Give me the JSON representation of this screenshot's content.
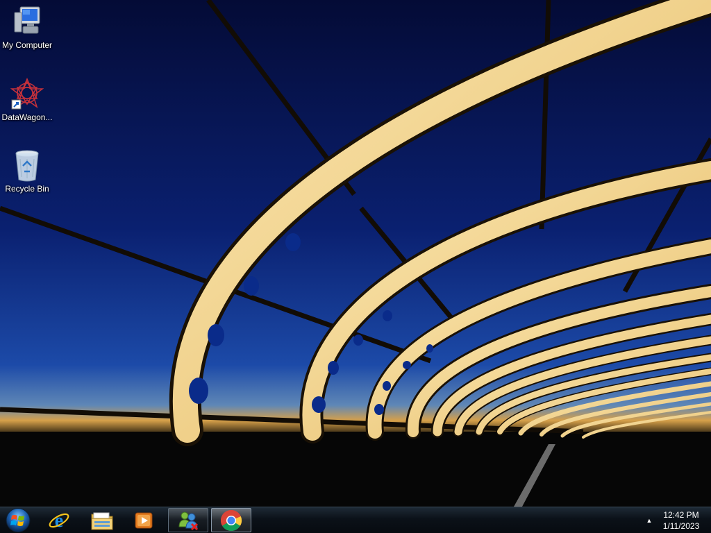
{
  "desktop": {
    "icons": [
      {
        "label": "My Computer",
        "icon": "computer-icon"
      },
      {
        "label": "DataWagon...",
        "icon": "datawagon-shortcut-icon"
      },
      {
        "label": "Recycle Bin",
        "icon": "recycle-bin-icon"
      }
    ]
  },
  "taskbar": {
    "start": {
      "icon": "windows-start-orb-icon"
    },
    "pinned": [
      {
        "icon": "internet-explorer-icon",
        "running": false
      },
      {
        "icon": "file-explorer-icon",
        "running": false
      },
      {
        "icon": "media-player-icon",
        "running": false
      },
      {
        "icon": "messenger-app-icon",
        "running": true
      },
      {
        "icon": "chrome-icon",
        "running": true,
        "active": true
      }
    ],
    "tray": {
      "show_hidden_icon": "tray-up-arrow-icon",
      "time": "12:42 PM",
      "date": "1/11/2023"
    }
  },
  "colors": {
    "sky_top": "#05103f",
    "sky_mid": "#0b2a8a",
    "horizon": "#d9a24a",
    "arch": "#f2dca0",
    "taskbar": "#0b1118"
  }
}
